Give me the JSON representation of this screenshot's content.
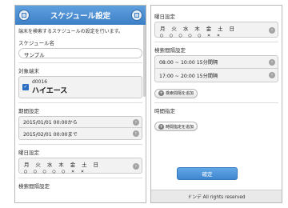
{
  "left": {
    "header_title": "スケジュール設定",
    "note": "端末を検索するスケジュールの設定を行います。",
    "schedule_name_label": "スケジュール名",
    "schedule_name_value": "サンプル",
    "target_terminal_label": "対象端末",
    "terminal_id": "d0016",
    "terminal_name": "ハイエース",
    "period_label": "期間設定",
    "period_from": "2015/01/01 00:00から",
    "period_to": "2015/02/01 00:00まで",
    "weekday_label": "曜日設定",
    "weekday_names": "月 火 水 木 金 土 日",
    "weekday_marks": "○ ○ ○ ○ ○ × ×",
    "interval_label": "検索間隔設定"
  },
  "right": {
    "weekday_label": "曜日設定",
    "weekday_names": "月 火 水 木 金 土 日",
    "weekday_marks": "○ ○ ○ ○ ○ × ×",
    "interval_label": "検索間隔設定",
    "interval_rows": [
      "08:00 ~ 10:00 15分間隔",
      "17:00 ~ 20:00 15分間隔"
    ],
    "add_interval_button": "検索間隔を追加",
    "time_spec_label": "時間指定",
    "add_time_button": "時間指定を追加",
    "decide_button": "確定",
    "footer": "ドンデ All rights reserved"
  }
}
